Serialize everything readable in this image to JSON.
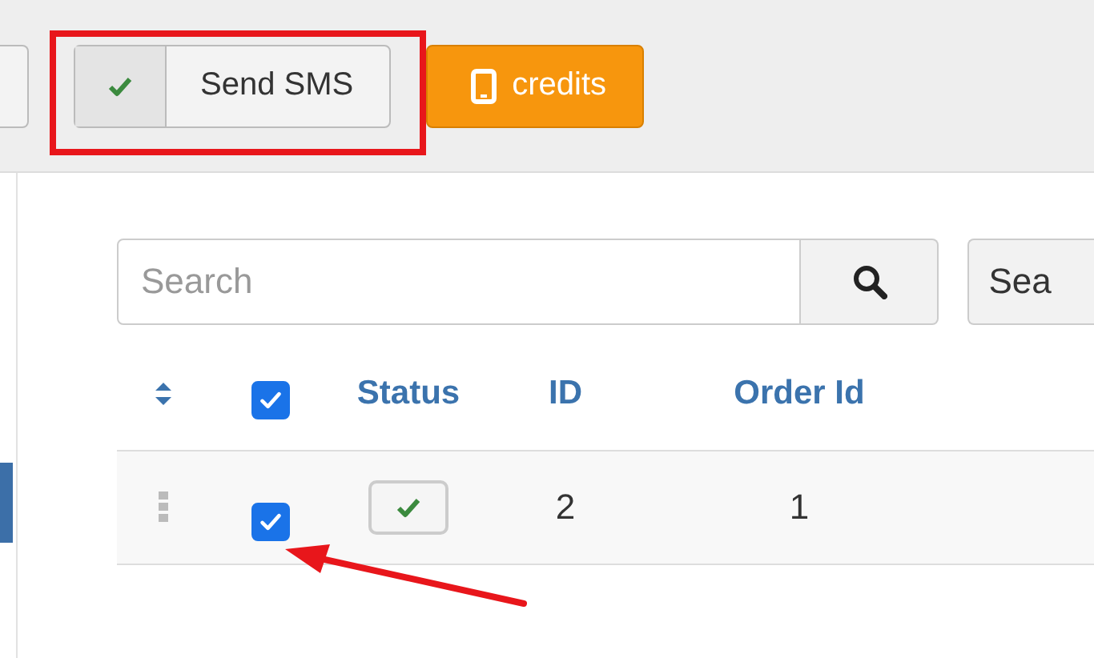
{
  "toolbar": {
    "send_button": {
      "label": "Send SMS",
      "highlighted": true
    },
    "credits_button": {
      "label": "credits"
    }
  },
  "search": {
    "placeholder": "Search",
    "button_label": "Sea"
  },
  "table": {
    "columns": [
      {
        "kind": "sort"
      },
      {
        "kind": "checkbox",
        "checked": true
      },
      {
        "kind": "text",
        "label": "Status"
      },
      {
        "kind": "text",
        "label": "ID"
      },
      {
        "kind": "text",
        "label": "Order Id"
      }
    ],
    "rows": [
      {
        "checked": true,
        "pointed_at": true,
        "status_ok": true,
        "cells": [
          "2",
          "1"
        ]
      }
    ]
  }
}
